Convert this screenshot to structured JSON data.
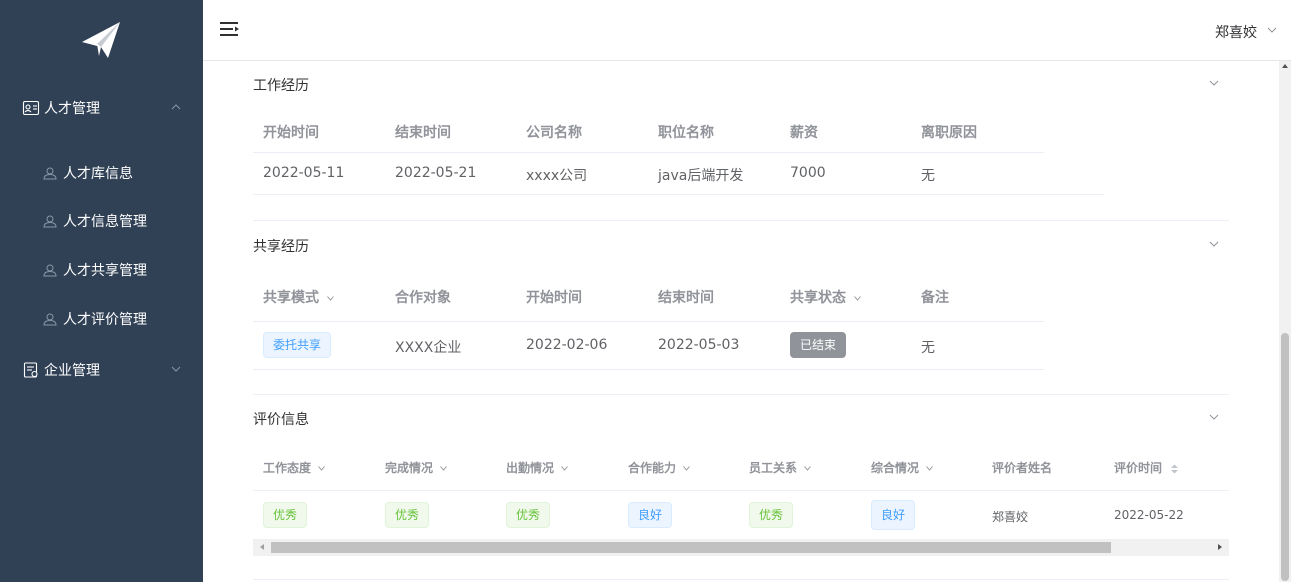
{
  "topbar": {
    "username": "郑喜姣"
  },
  "sidebar": {
    "groups": [
      {
        "label": "人才管理",
        "expanded": true
      },
      {
        "label": "企业管理",
        "expanded": false
      }
    ],
    "items": [
      {
        "label": "人才库信息"
      },
      {
        "label": "人才信息管理"
      },
      {
        "label": "人才共享管理"
      },
      {
        "label": "人才评价管理"
      }
    ]
  },
  "work_history": {
    "title": "工作经历",
    "columns": [
      "开始时间",
      "结束时间",
      "公司名称",
      "职位名称",
      "薪资",
      "离职原因"
    ],
    "rows": [
      {
        "start": "2022-05-11",
        "end": "2022-05-21",
        "company": "xxxx公司",
        "position": "java后端开发",
        "salary": "7000",
        "reason": "无"
      }
    ]
  },
  "share_history": {
    "title": "共享经历",
    "columns": [
      "共享模式",
      "合作对象",
      "开始时间",
      "结束时间",
      "共享状态",
      "备注"
    ],
    "rows": [
      {
        "mode": "委托共享",
        "partner": "XXXX企业",
        "start": "2022-02-06",
        "end": "2022-05-03",
        "status": "已结束",
        "note": "无"
      }
    ]
  },
  "evaluation": {
    "title": "评价信息",
    "columns": [
      "工作态度",
      "完成情况",
      "出勤情况",
      "合作能力",
      "员工关系",
      "综合情况",
      "评价者姓名",
      "评价时间"
    ],
    "rows": [
      {
        "attitude": "优秀",
        "completion": "优秀",
        "attendance": "优秀",
        "cooperation": "良好",
        "relations": "优秀",
        "overall": "良好",
        "evaluator": "郑喜姣",
        "time": "2022-05-22"
      }
    ]
  },
  "colors": {
    "sidebar_bg": "#304156",
    "tag_green": "#67c23a",
    "tag_blue": "#409eff",
    "tag_gray": "#909399"
  },
  "icons": [
    "paper-plane-logo-icon",
    "hamburger-icon",
    "chevron-down-icon",
    "chevron-up-icon",
    "id-card-icon",
    "user-icon",
    "building-document-icon",
    "sort-icon"
  ]
}
